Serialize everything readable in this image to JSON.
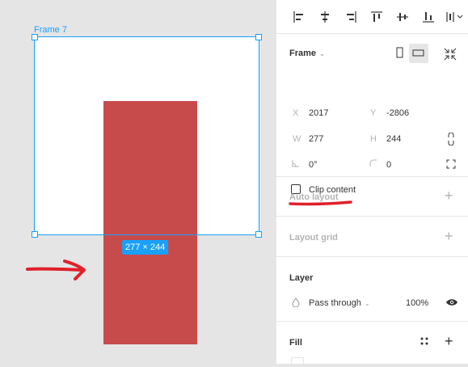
{
  "canvas": {
    "frame_label": "Frame 7",
    "size_tag": "277 × 244",
    "frame_color": "#ffffff",
    "rect_color": "#c84b4b",
    "selection_color": "#18a0fb",
    "background": "#e5e5e5"
  },
  "toolbar": {
    "align_icons": [
      "align-left-icon",
      "align-horizontal-center-icon",
      "align-right-icon",
      "align-top-icon",
      "align-vertical-center-icon",
      "align-bottom-icon",
      "distribute-icon"
    ]
  },
  "frame_section": {
    "title": "Frame",
    "x_label": "X",
    "x_value": "2017",
    "y_label": "Y",
    "y_value": "-2806",
    "w_label": "W",
    "w_value": "277",
    "h_label": "H",
    "h_value": "244",
    "rotation_value": "0°",
    "radius_value": "0",
    "clip_label": "Clip content",
    "clip_checked": false
  },
  "auto_layout": {
    "title": "Auto layout"
  },
  "layout_grid": {
    "title": "Layout grid"
  },
  "layer": {
    "title": "Layer",
    "blend_mode": "Pass through",
    "opacity": "100%"
  },
  "fill": {
    "title": "Fill"
  },
  "annotation_color": "#e0202a"
}
